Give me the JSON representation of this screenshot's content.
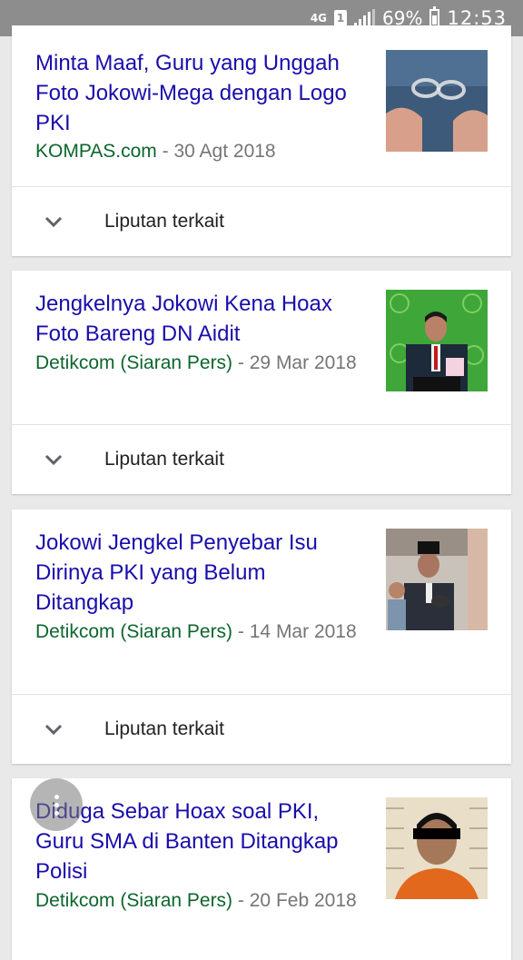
{
  "status_bar": {
    "network": "4G",
    "sim": "1",
    "battery": "69%",
    "time": "12:53"
  },
  "articles": [
    {
      "title": "Minta Maaf, Guru yang Unggah Foto Jokowi-Mega dengan Logo PKI",
      "source": "KOMPAS.com",
      "separator": "-",
      "date": "30 Agt 2018",
      "related_label": "Liputan terkait",
      "thumb_icon": "handcuffs-photo"
    },
    {
      "title": "Jengkelnya Jokowi Kena Hoax Foto Bareng DN Aidit",
      "source": "Detikcom (Siaran Pers)",
      "separator": "-",
      "date": "29 Mar 2018",
      "related_label": "Liputan terkait",
      "thumb_icon": "speaker-green-backdrop-photo"
    },
    {
      "title": "Jokowi Jengkel Penyebar Isu Dirinya PKI yang Belum Ditangkap",
      "source": "Detikcom (Siaran Pers)",
      "separator": "-",
      "date": "14 Mar 2018",
      "related_label": "Liputan terkait",
      "thumb_icon": "press-interview-photo"
    },
    {
      "title": "Diduga Sebar Hoax soal PKI, Guru SMA di Banten Ditangkap Polisi",
      "source": "Detikcom (Siaran Pers)",
      "separator": "-",
      "date": "20 Feb 2018",
      "thumb_icon": "mugshot-photo"
    }
  ],
  "colors": {
    "headline": "#1a0dab",
    "source": "#0d652d",
    "date": "#757575",
    "statusbar": "#8d8d8d"
  }
}
